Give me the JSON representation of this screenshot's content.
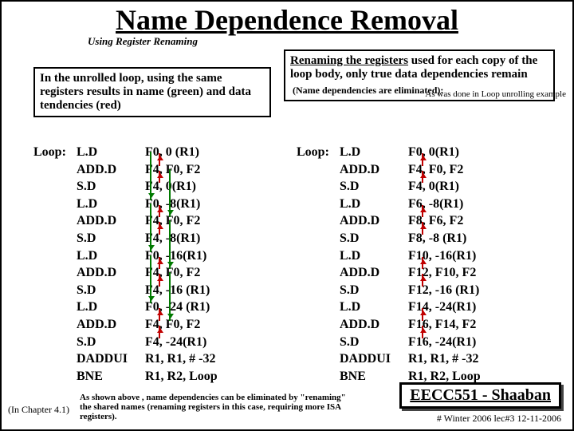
{
  "title": "Name Dependence Removal",
  "subtitle": "Using Register Renaming",
  "box1": "In the unrolled loop, using the same registers results in name (green) and data tendencies (red)",
  "box2": {
    "p1a": "Renaming the registers",
    "p1b": " used for each copy of the loop body, only true data dependencies remain",
    "p2": "(Name dependencies are eliminated):"
  },
  "sidenote": "As was done in\nLoop unrolling\nexample",
  "left_code": [
    {
      "lp": "Loop:",
      "op": "L.D",
      "arg": "F0, 0 (R1)"
    },
    {
      "lp": "",
      "op": "ADD.D",
      "arg": "F4, F0, F2"
    },
    {
      "lp": "",
      "op": "S.D",
      "arg": "F4, 0(R1)"
    },
    {
      "lp": "",
      "op": "L.D",
      "arg": "F0, -8(R1)"
    },
    {
      "lp": "",
      "op": "ADD.D",
      "arg": "F4, F0, F2"
    },
    {
      "lp": "",
      "op": "S.D",
      "arg": "F4, -8(R1)"
    },
    {
      "lp": "",
      "op": "L.D",
      "arg": "F0, -16(R1)"
    },
    {
      "lp": "",
      "op": "ADD.D",
      "arg": "F4, F0, F2"
    },
    {
      "lp": "",
      "op": "S.D",
      "arg": "F4, -16 (R1)"
    },
    {
      "lp": "",
      "op": "L.D",
      "arg": "F0, -24 (R1)"
    },
    {
      "lp": "",
      "op": "ADD.D",
      "arg": "F4, F0, F2"
    },
    {
      "lp": "",
      "op": "S.D",
      "arg": "F4, -24(R1)"
    },
    {
      "lp": "",
      "op": "DADDUI",
      "arg": "R1, R1, # -32"
    },
    {
      "lp": "",
      "op": "BNE",
      "arg": "R1, R2, Loop"
    }
  ],
  "right_code": [
    {
      "lp": "Loop:",
      "op": "L.D",
      "arg": "F0, 0(R1)"
    },
    {
      "lp": "",
      "op": "ADD.D",
      "arg": "F4, F0, F2"
    },
    {
      "lp": "",
      "op": "S.D",
      "arg": "F4, 0(R1)"
    },
    {
      "lp": "",
      "op": "L.D",
      "arg": "F6, -8(R1)"
    },
    {
      "lp": "",
      "op": "ADD.D",
      "arg": "F8, F6, F2"
    },
    {
      "lp": "",
      "op": "S.D",
      "arg": "F8, -8 (R1)"
    },
    {
      "lp": "",
      "op": "L.D",
      "arg": "F10, -16(R1)"
    },
    {
      "lp": "",
      "op": "ADD.D",
      "arg": "F12, F10, F2"
    },
    {
      "lp": "",
      "op": "S.D",
      "arg": "F12, -16 (R1)"
    },
    {
      "lp": "",
      "op": "L.D",
      "arg": "F14, -24(R1)"
    },
    {
      "lp": "",
      "op": "ADD.D",
      "arg": "F16, F14, F2"
    },
    {
      "lp": "",
      "op": "S.D",
      "arg": "F16, -24(R1)"
    },
    {
      "lp": "",
      "op": "DADDUI",
      "arg": "R1, R1, # -32"
    },
    {
      "lp": "",
      "op": "BNE",
      "arg": "R1, R2, Loop"
    }
  ],
  "footnote": "As shown above , name dependencies can be eliminated by \"renaming\" the shared names\n(renaming registers in this case, requiring more ISA registers).",
  "chapref": "(In  Chapter 4.1)",
  "course": "EECC551 - Shaaban",
  "lecinfo": "#  Winter 2006  lec#3    12-11-2006"
}
